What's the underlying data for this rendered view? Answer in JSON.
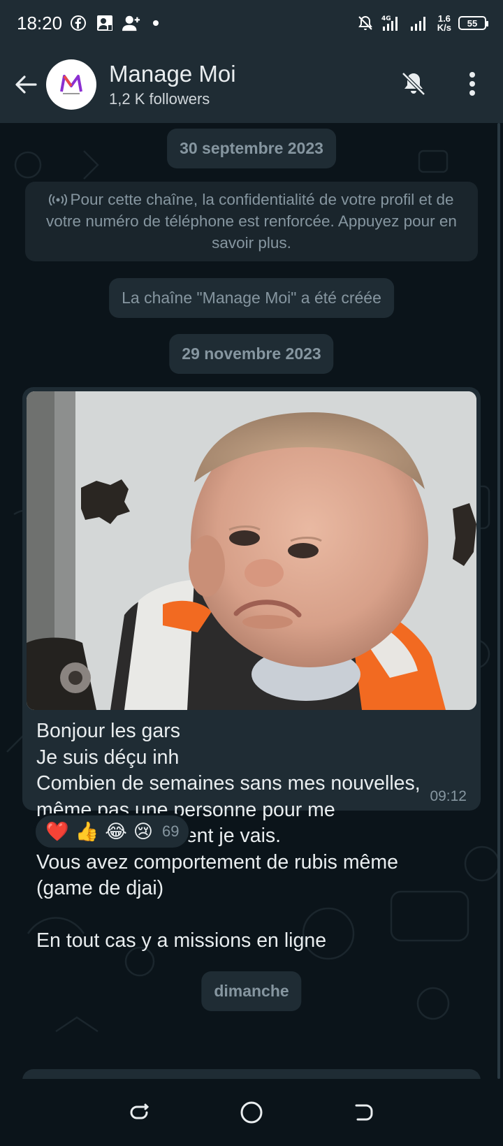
{
  "status_bar": {
    "time": "18:20",
    "net_speed_value": "1.6",
    "net_speed_unit": "K/s",
    "battery": "55",
    "network_label": "4G"
  },
  "header": {
    "channel_name": "Manage Moi",
    "followers": "1,2 K followers",
    "icons": [
      "back-arrow-icon",
      "bell-off-icon",
      "more-vertical-icon"
    ]
  },
  "chat": {
    "date1": "30 septembre 2023",
    "privacy_notice": "Pour cette chaîne, la confidentialité de votre profil et de votre numéro de téléphone est renforcée. Appuyez pour en savoir plus.",
    "channel_created": "La chaîne \"Manage Moi\" a été créée",
    "date2": "29 novembre 2023",
    "message": {
      "text": "Bonjour les gars\nJe suis déçu inh\nCombien de semaines sans mes nouvelles,\nmême pas une personne pour me\ndemander comment je vais.\nVous avez comportement de rubis même\n(game de djai)\n\nEn tout cas y a missions en ligne",
      "time": "09:12",
      "reactions": [
        "❤️",
        "👍",
        "😂",
        "😢"
      ],
      "reaction_count": "69"
    },
    "date3": "dimanche"
  },
  "colors": {
    "background": "#0b141a",
    "panel": "#1f2c34",
    "muted_text": "#8696a0",
    "primary_text": "#e9edef"
  }
}
